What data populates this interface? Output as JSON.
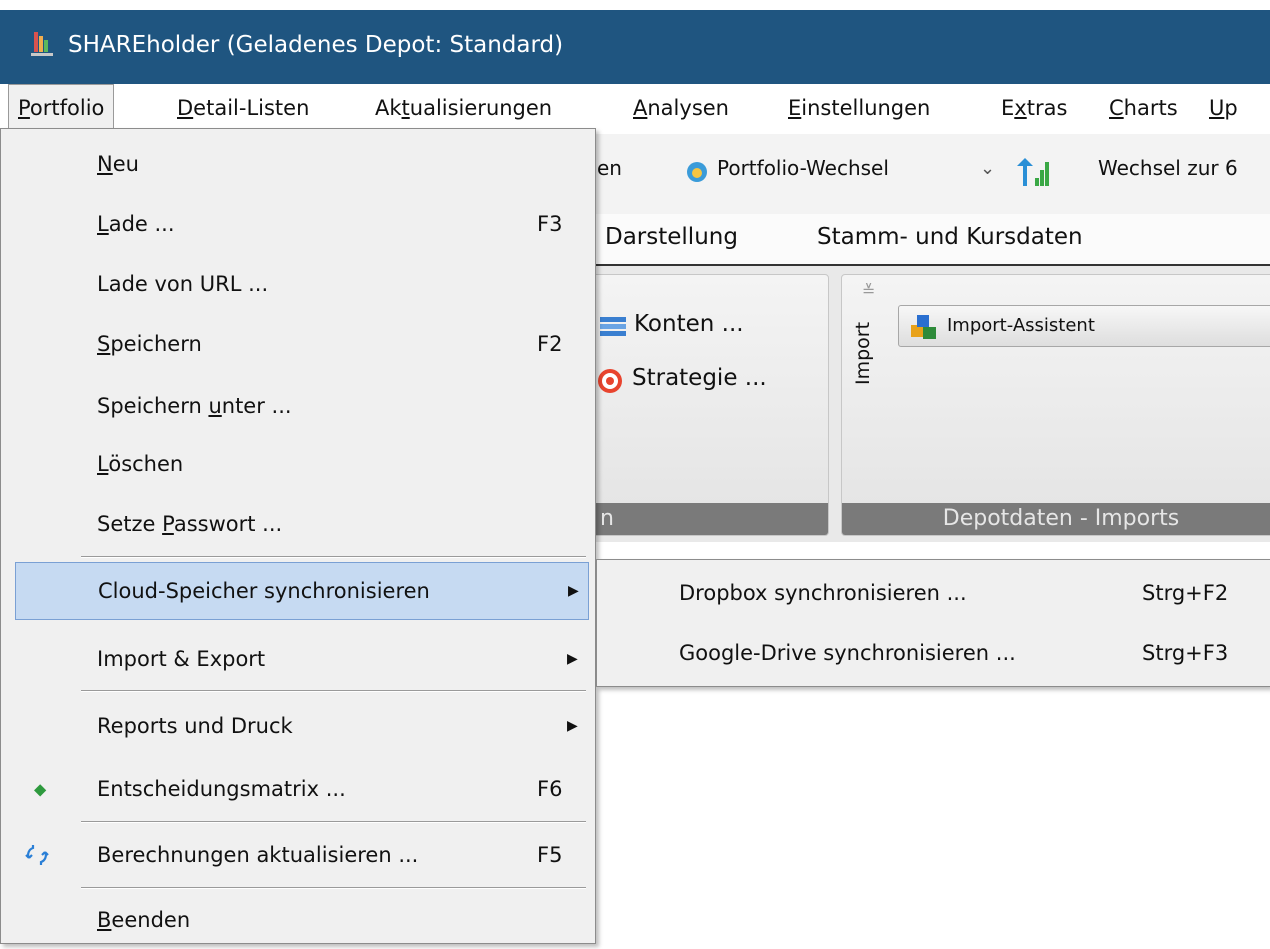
{
  "window": {
    "title": "SHAREholder (Geladenes Depot: Standard)"
  },
  "menubar": {
    "items": [
      {
        "pre": "",
        "u": "P",
        "post": "ortfolio"
      },
      {
        "pre": "",
        "u": "D",
        "post": "etail-Listen"
      },
      {
        "pre": "Ak",
        "u": "t",
        "post": "ualisierungen"
      },
      {
        "pre": "",
        "u": "A",
        "post": "nalysen"
      },
      {
        "pre": "",
        "u": "E",
        "post": "instellungen"
      },
      {
        "pre": "E",
        "u": "x",
        "post": "tras"
      },
      {
        "pre": "",
        "u": "C",
        "post": "harts"
      },
      {
        "pre": "",
        "u": "U",
        "post": "p"
      }
    ]
  },
  "toolbar": {
    "partial_text": "en",
    "portfolio_switch": "Portfolio-Wechsel",
    "switch_to": "Wechsel zur 6"
  },
  "ribbon": {
    "tabs": [
      "Darstellung",
      "Stamm- und Kursdaten"
    ],
    "konten": "Konten ...",
    "strategie": "Strategie ...",
    "left_group_footer": "n",
    "import_group_label": "Import",
    "import_assistant": "Import-Assistent",
    "import_group_footer": "Depotdaten - Imports"
  },
  "portfolio_menu": {
    "neu": {
      "pre": "",
      "u": "N",
      "post": "eu"
    },
    "lade": {
      "pre": "",
      "u": "L",
      "post": "ade ...",
      "shortcut": "F3"
    },
    "lade_url": "Lade von URL ...",
    "speichern": {
      "pre": "",
      "u": "S",
      "post": "peichern",
      "shortcut": "F2"
    },
    "speichern_unter": {
      "pre": "Speichern ",
      "u": "u",
      "post": "nter ..."
    },
    "loeschen": {
      "pre": "",
      "u": "L",
      "post": "öschen"
    },
    "passwort": {
      "pre": "Setze ",
      "u": "P",
      "post": "asswort ..."
    },
    "cloud": "Cloud-Speicher synchronisieren",
    "import_export": "Import & Export",
    "reports": "Reports und Druck",
    "matrix": {
      "label": "Entscheidungsmatrix ...",
      "shortcut": "F6"
    },
    "berechnungen": {
      "label": "Berechnungen aktualisieren ...",
      "shortcut": "F5"
    },
    "beenden": {
      "pre": "",
      "u": "B",
      "post": "eenden"
    }
  },
  "cloud_submenu": {
    "dropbox": {
      "label": "Dropbox synchronisieren ...",
      "shortcut": "Strg+F2"
    },
    "gdrive": {
      "label": "Google-Drive synchronisieren ...",
      "shortcut": "Strg+F3"
    }
  }
}
